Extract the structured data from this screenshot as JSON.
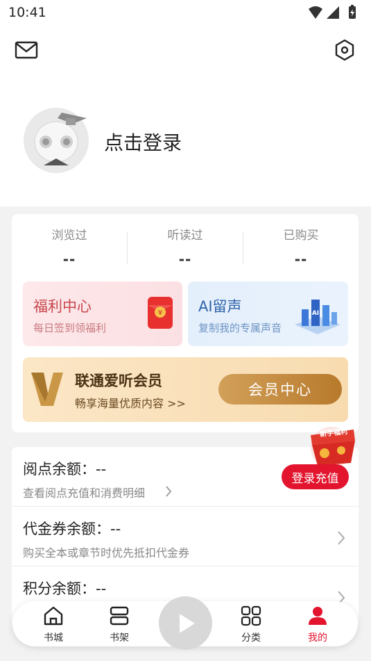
{
  "status_bar": {
    "time": "10:41"
  },
  "profile": {
    "login_label": "点击登录"
  },
  "stats": [
    {
      "label": "浏览过",
      "value": "--"
    },
    {
      "label": "听读过",
      "value": "--"
    },
    {
      "label": "已购买",
      "value": "--"
    }
  ],
  "welfare": {
    "title": "福利中心",
    "subtitle": "每日签到领福利"
  },
  "ai_voice": {
    "title": "AI留声",
    "subtitle": "复制我的专属声音"
  },
  "vip": {
    "title": "联通爱听会员",
    "subtitle": "畅享海量优质内容 >>",
    "button": "会员中心"
  },
  "gift": {
    "badge": "新手福利"
  },
  "balances": [
    {
      "title": "阅点余额：--",
      "subtitle": "查看阅点充值和消费明细"
    },
    {
      "title": "代金券余额：--",
      "subtitle": "购买全本或章节时优先抵扣代金券"
    },
    {
      "title": "积分余额：--",
      "subtitle": ""
    }
  ],
  "recharge_button": "登录充值",
  "tabs": [
    {
      "label": "书城",
      "icon": "home-icon"
    },
    {
      "label": "书架",
      "icon": "bookshelf-icon"
    },
    {
      "label": "分类",
      "icon": "grid-icon"
    },
    {
      "label": "我的",
      "icon": "person-icon"
    }
  ],
  "colors": {
    "accent": "#e3142d",
    "gold": "#b87a2c"
  }
}
